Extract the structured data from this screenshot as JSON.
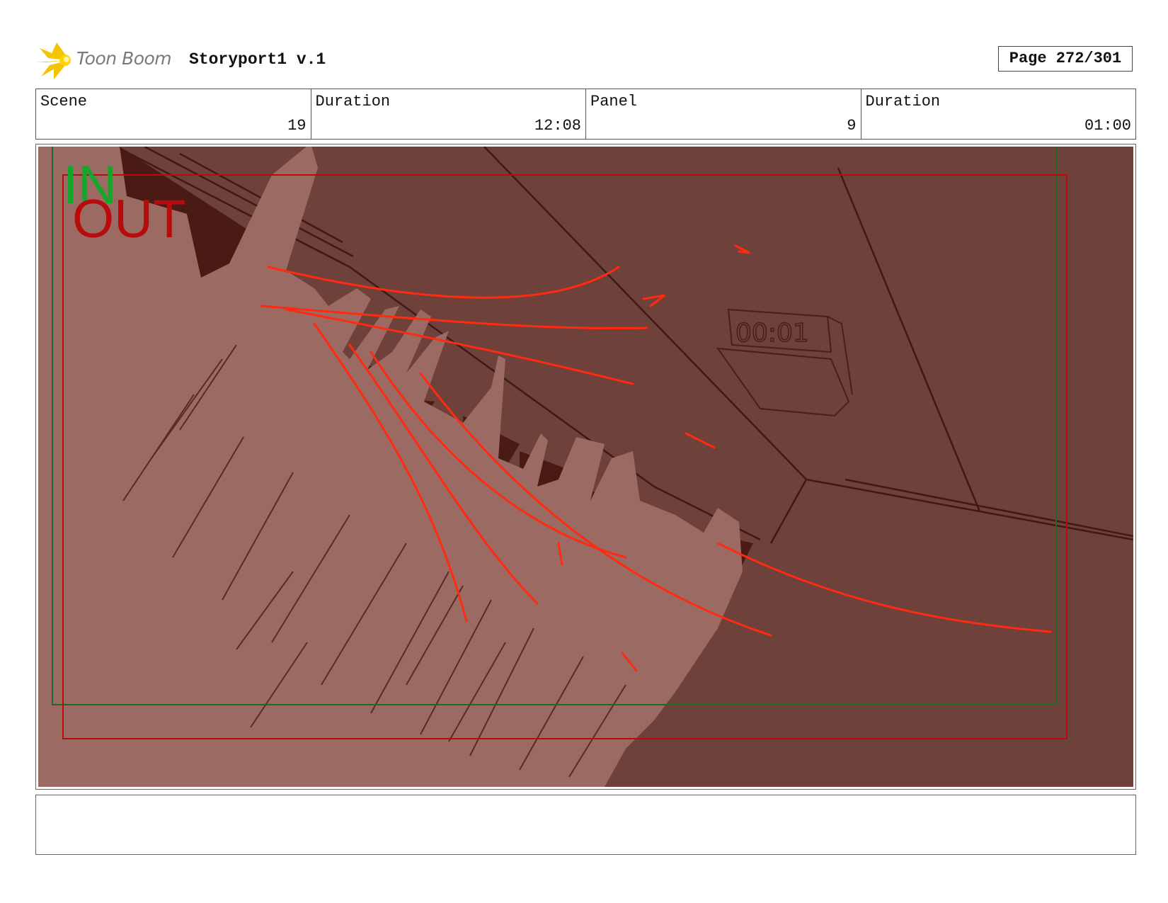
{
  "header": {
    "brand": "Toon Boom",
    "title": "Storyport1 v.1",
    "page": "Page 272/301"
  },
  "info": {
    "scene_label": "Scene",
    "scene_value": "19",
    "scene_duration_label": "Duration",
    "scene_duration_value": "12:08",
    "panel_label": "Panel",
    "panel_value": "9",
    "panel_duration_label": "Duration",
    "panel_duration_value": "01:00"
  },
  "panel": {
    "in_marker": "IN",
    "out_marker": "OUT",
    "timer_display": "00:01",
    "colors": {
      "background": "#6e413b",
      "hand": "#9b6a62",
      "shadow": "#4a1a14",
      "action_lines": "#ff2a10",
      "safe_frame_in": "#1e6a1e",
      "safe_frame_out": "#b80c0c"
    }
  },
  "notes": {
    "text": ""
  }
}
